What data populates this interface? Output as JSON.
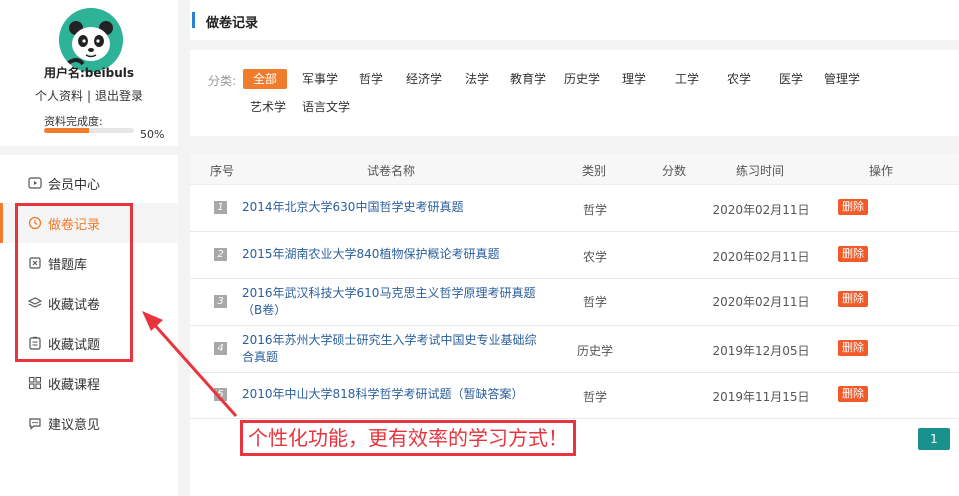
{
  "profile": {
    "username": "用户名:beibuls",
    "links": {
      "info": "个人资料",
      "separator": "|",
      "logout": "退出登录"
    },
    "completion": {
      "label": "资料完成度:",
      "percent_text": "50%",
      "value": 0.5
    }
  },
  "sidebar": {
    "items": [
      {
        "label": "会员中心",
        "icon": "play-square-icon"
      },
      {
        "label": "做卷记录",
        "icon": "history-clock-icon",
        "active": true
      },
      {
        "label": "错题库",
        "icon": "error-book-icon"
      },
      {
        "label": "收藏试卷",
        "icon": "layers-icon"
      },
      {
        "label": "收藏试题",
        "icon": "clipboard-icon"
      },
      {
        "label": "收藏课程",
        "icon": "grid-icon"
      },
      {
        "label": "建议意见",
        "icon": "chat-icon"
      }
    ]
  },
  "header": {
    "title": "做卷记录"
  },
  "filter": {
    "label": "分类:",
    "categories": [
      "全部",
      "军事学",
      "哲学",
      "经济学",
      "法学",
      "教育学",
      "历史学",
      "理学",
      "工学",
      "农学",
      "医学",
      "管理学",
      "艺术学",
      "语言文学"
    ]
  },
  "table": {
    "columns": [
      "序号",
      "试卷名称",
      "类别",
      "分数",
      "练习时间",
      "操作"
    ],
    "rows": [
      {
        "num": "1",
        "name": "2014年北京大学630中国哲学史考研真题",
        "category": "哲学",
        "score": "",
        "date": "2020年02月11日",
        "action": "删除"
      },
      {
        "num": "2",
        "name": "2015年湖南农业大学840植物保护概论考研真题",
        "category": "农学",
        "score": "",
        "date": "2020年02月11日",
        "action": "删除"
      },
      {
        "num": "3",
        "name": "2016年武汉科技大学610马克思主义哲学原理考研真题（B卷）",
        "category": "哲学",
        "score": "",
        "date": "2020年02月11日",
        "action": "删除"
      },
      {
        "num": "4",
        "name": "2016年苏州大学硕士研究生入学考试中国史专业基础综合真题",
        "category": "历史学",
        "score": "",
        "date": "2019年12月05日",
        "action": "删除"
      },
      {
        "num": "5",
        "name": "2010年中山大学818科学哲学考研试题（暂缺答案）",
        "category": "哲学",
        "score": "",
        "date": "2019年11月15日",
        "action": "删除"
      }
    ]
  },
  "pagination": {
    "current": "1"
  },
  "annotation": {
    "text": "个性化功能，更有效率的学习方式！",
    "color": "#e8343d"
  },
  "colors": {
    "accent": "#f07c2c",
    "link": "#2a5f9e",
    "delete": "#f25a2a",
    "page": "#19918c"
  }
}
